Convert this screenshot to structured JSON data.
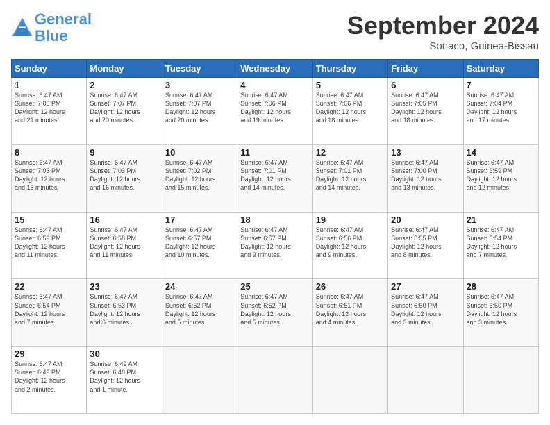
{
  "header": {
    "logo_line1": "General",
    "logo_line2": "Blue",
    "month_title": "September 2024",
    "location": "Sonaco, Guinea-Bissau"
  },
  "weekdays": [
    "Sunday",
    "Monday",
    "Tuesday",
    "Wednesday",
    "Thursday",
    "Friday",
    "Saturday"
  ],
  "weeks": [
    [
      {
        "day": "1",
        "info": "Sunrise: 6:47 AM\nSunset: 7:08 PM\nDaylight: 12 hours\nand 21 minutes."
      },
      {
        "day": "2",
        "info": "Sunrise: 6:47 AM\nSunset: 7:07 PM\nDaylight: 12 hours\nand 20 minutes."
      },
      {
        "day": "3",
        "info": "Sunrise: 6:47 AM\nSunset: 7:07 PM\nDaylight: 12 hours\nand 20 minutes."
      },
      {
        "day": "4",
        "info": "Sunrise: 6:47 AM\nSunset: 7:06 PM\nDaylight: 12 hours\nand 19 minutes."
      },
      {
        "day": "5",
        "info": "Sunrise: 6:47 AM\nSunset: 7:06 PM\nDaylight: 12 hours\nand 18 minutes."
      },
      {
        "day": "6",
        "info": "Sunrise: 6:47 AM\nSunset: 7:05 PM\nDaylight: 12 hours\nand 18 minutes."
      },
      {
        "day": "7",
        "info": "Sunrise: 6:47 AM\nSunset: 7:04 PM\nDaylight: 12 hours\nand 17 minutes."
      }
    ],
    [
      {
        "day": "8",
        "info": "Sunrise: 6:47 AM\nSunset: 7:03 PM\nDaylight: 12 hours\nand 16 minutes."
      },
      {
        "day": "9",
        "info": "Sunrise: 6:47 AM\nSunset: 7:03 PM\nDaylight: 12 hours\nand 16 minutes."
      },
      {
        "day": "10",
        "info": "Sunrise: 6:47 AM\nSunset: 7:02 PM\nDaylight: 12 hours\nand 15 minutes."
      },
      {
        "day": "11",
        "info": "Sunrise: 6:47 AM\nSunset: 7:01 PM\nDaylight: 12 hours\nand 14 minutes."
      },
      {
        "day": "12",
        "info": "Sunrise: 6:47 AM\nSunset: 7:01 PM\nDaylight: 12 hours\nand 14 minutes."
      },
      {
        "day": "13",
        "info": "Sunrise: 6:47 AM\nSunset: 7:00 PM\nDaylight: 12 hours\nand 13 minutes."
      },
      {
        "day": "14",
        "info": "Sunrise: 6:47 AM\nSunset: 6:59 PM\nDaylight: 12 hours\nand 12 minutes."
      }
    ],
    [
      {
        "day": "15",
        "info": "Sunrise: 6:47 AM\nSunset: 6:59 PM\nDaylight: 12 hours\nand 11 minutes."
      },
      {
        "day": "16",
        "info": "Sunrise: 6:47 AM\nSunset: 6:58 PM\nDaylight: 12 hours\nand 11 minutes."
      },
      {
        "day": "17",
        "info": "Sunrise: 6:47 AM\nSunset: 6:57 PM\nDaylight: 12 hours\nand 10 minutes."
      },
      {
        "day": "18",
        "info": "Sunrise: 6:47 AM\nSunset: 6:57 PM\nDaylight: 12 hours\nand 9 minutes."
      },
      {
        "day": "19",
        "info": "Sunrise: 6:47 AM\nSunset: 6:56 PM\nDaylight: 12 hours\nand 9 minutes."
      },
      {
        "day": "20",
        "info": "Sunrise: 6:47 AM\nSunset: 6:55 PM\nDaylight: 12 hours\nand 8 minutes."
      },
      {
        "day": "21",
        "info": "Sunrise: 6:47 AM\nSunset: 6:54 PM\nDaylight: 12 hours\nand 7 minutes."
      }
    ],
    [
      {
        "day": "22",
        "info": "Sunrise: 6:47 AM\nSunset: 6:54 PM\nDaylight: 12 hours\nand 7 minutes."
      },
      {
        "day": "23",
        "info": "Sunrise: 6:47 AM\nSunset: 6:53 PM\nDaylight: 12 hours\nand 6 minutes."
      },
      {
        "day": "24",
        "info": "Sunrise: 6:47 AM\nSunset: 6:52 PM\nDaylight: 12 hours\nand 5 minutes."
      },
      {
        "day": "25",
        "info": "Sunrise: 6:47 AM\nSunset: 6:52 PM\nDaylight: 12 hours\nand 5 minutes."
      },
      {
        "day": "26",
        "info": "Sunrise: 6:47 AM\nSunset: 6:51 PM\nDaylight: 12 hours\nand 4 minutes."
      },
      {
        "day": "27",
        "info": "Sunrise: 6:47 AM\nSunset: 6:50 PM\nDaylight: 12 hours\nand 3 minutes."
      },
      {
        "day": "28",
        "info": "Sunrise: 6:47 AM\nSunset: 6:50 PM\nDaylight: 12 hours\nand 3 minutes."
      }
    ],
    [
      {
        "day": "29",
        "info": "Sunrise: 6:47 AM\nSunset: 6:49 PM\nDaylight: 12 hours\nand 2 minutes."
      },
      {
        "day": "30",
        "info": "Sunrise: 6:49 AM\nSunset: 6:48 PM\nDaylight: 12 hours\nand 1 minute."
      },
      {
        "day": "",
        "info": ""
      },
      {
        "day": "",
        "info": ""
      },
      {
        "day": "",
        "info": ""
      },
      {
        "day": "",
        "info": ""
      },
      {
        "day": "",
        "info": ""
      }
    ]
  ]
}
